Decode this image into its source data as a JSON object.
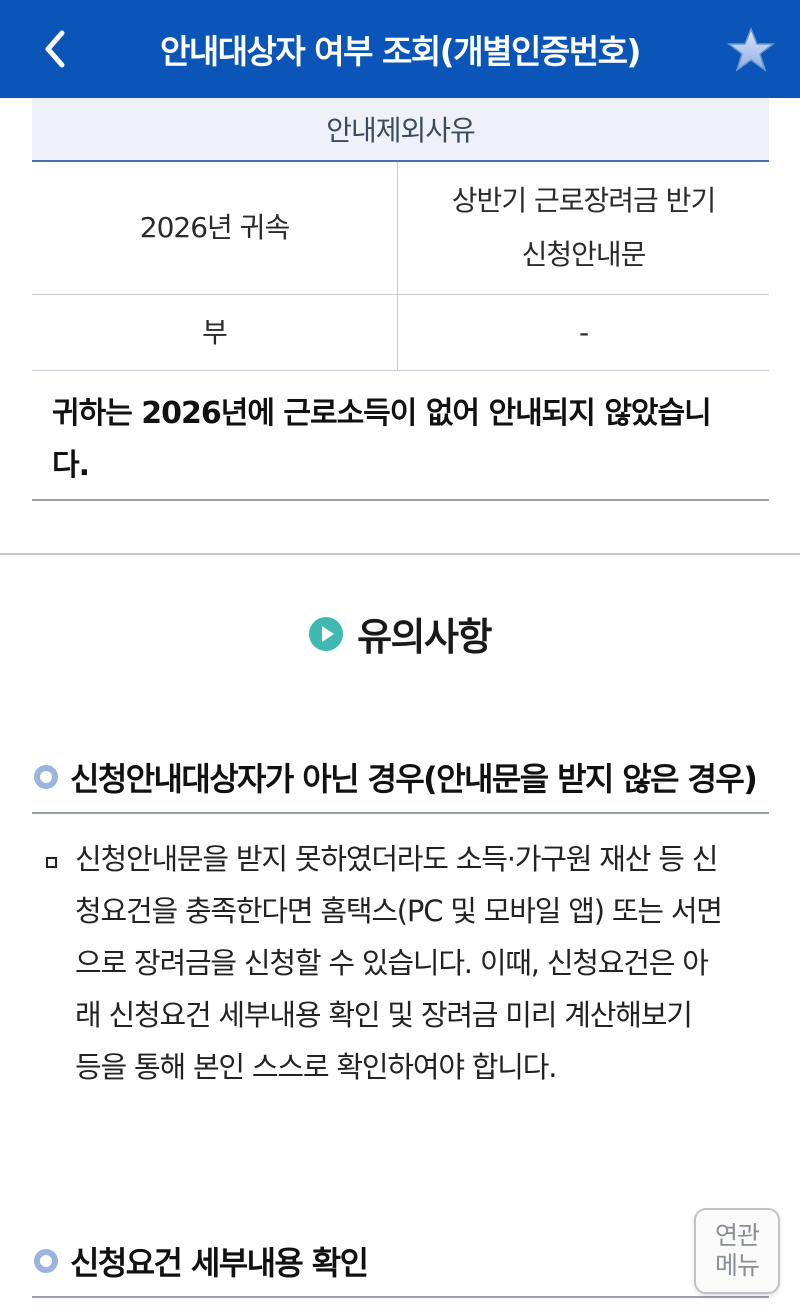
{
  "header": {
    "title": "안내대상자 여부 조회(개별인증번호)",
    "back_icon": "chevron-left-icon",
    "star_icon": "star-icon"
  },
  "table": {
    "header_right": "안내제외사유",
    "rows": [
      {
        "left": "2026년 귀속",
        "right_line1": "상반기 근로장려금 반기",
        "right_line2": "신청안내문"
      },
      {
        "left": "부",
        "right": "-"
      }
    ],
    "note_line1": "귀하는 2026년에 근로소득이 없어 안내되지 않았습니",
    "note_line2": "다."
  },
  "caution": {
    "title": "유의사항"
  },
  "section1": {
    "title": "신청안내대상자가 아닌 경우(안내문을 받지 않은 경우)",
    "lines": [
      "신청안내문을 받지 못하였더라도 소득·가구원 재산 등 신",
      "청요건을 충족한다면 홈택스(PC 및 모바일 앱) 또는 서면",
      "으로 장려금을 신청할 수 있습니다. 이때, 신청요건은 아",
      "래 신청요건 세부내용 확인 및 장려금 미리 계산해보기",
      "등을 통해 본인 스스로 확인하여야 합니다."
    ]
  },
  "section2": {
    "title": "신청요건 세부내용 확인"
  },
  "related_menu": {
    "line1": "연관",
    "line2": "메뉴"
  },
  "colors": {
    "header_bg": "#0b55b9",
    "accent_teal": "#3fb9b1",
    "bullet_blue": "#9bb3dd"
  }
}
